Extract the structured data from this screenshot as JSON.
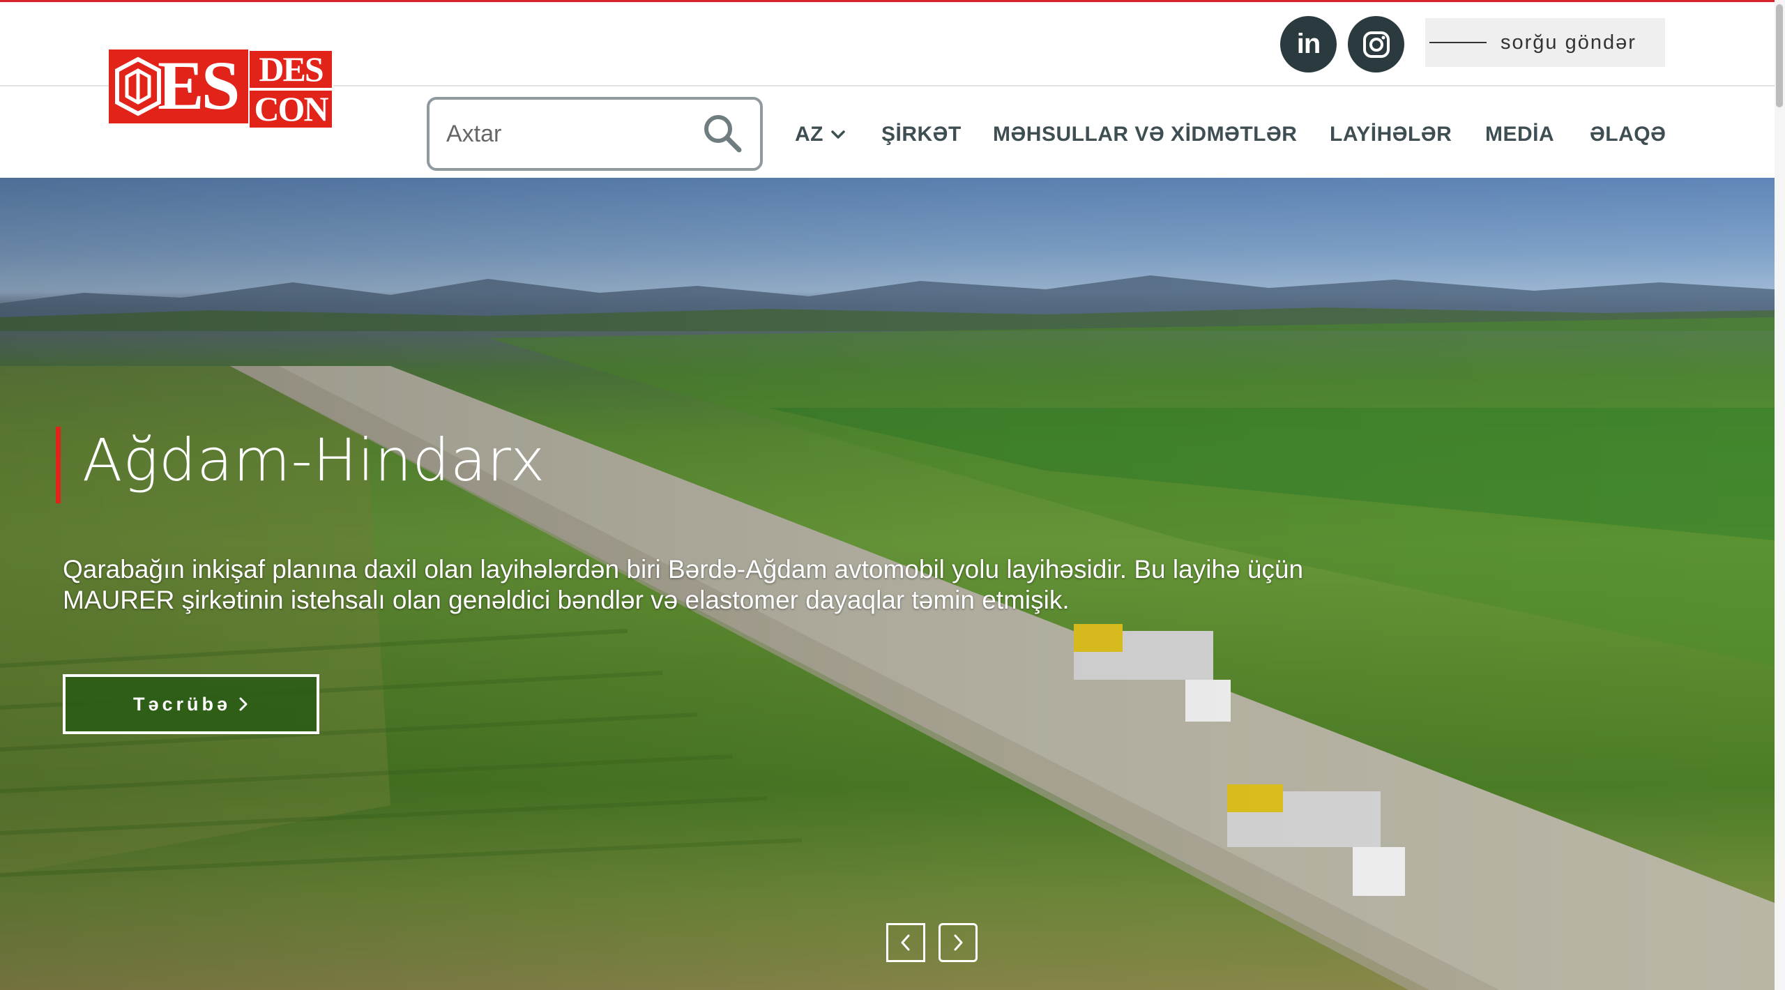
{
  "brand": {
    "logo_main": "ES",
    "logo_top": "DES",
    "logo_bottom": "CON",
    "color": "#e2231a"
  },
  "header": {
    "social": [
      {
        "icon": "linkedin-icon",
        "label": "in"
      },
      {
        "icon": "instagram-icon"
      }
    ],
    "inquiry_label": "sorğu göndər",
    "search": {
      "placeholder": "Axtar",
      "value": ""
    },
    "nav": {
      "language": "AZ",
      "items": [
        "ŞİRKƏT",
        "MƏHSULLAR VƏ XİDMƏTLƏR",
        "LAYİHƏLƏR",
        "MEDİA",
        "ƏLAQƏ"
      ]
    }
  },
  "hero": {
    "title": "Ağdam-Hindarx",
    "text": "Qarabağın inkişaf planına daxil olan layihələrdən biri Bərdə-Ağdam avtomobil yolu layihəsidir. Bu layihə üçün MAURER şirkətinin istehsalı olan genəldici bəndlər və elastomer dayaqlar təmin etmişik.",
    "cta_label": "Təcrübə",
    "accent_color": "#e2231a"
  }
}
